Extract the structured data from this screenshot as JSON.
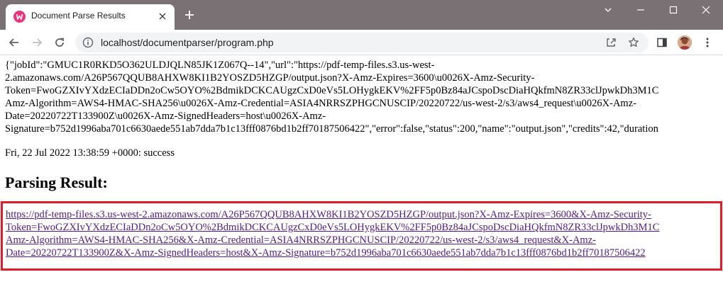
{
  "browser": {
    "tab_title": "Document Parse Results",
    "url": "localhost/documentparser/program.php"
  },
  "page": {
    "json_lines": [
      "{\"jobId\":\"GMUC1R0RKD5O362ULDJQLN85JK1Z067Q--14\",\"url\":\"https://pdf-temp-files.s3.us-west-",
      "2.amazonaws.com/A26P567QQUB8AHXW8KI1B2YOSZD5HZGP/output.json?X-Amz-Expires=3600\\u0026X-Amz-Security-",
      "Token=FwoGZXIvYXdzECIaDDn2oCw5OYO%2BdmikDCKCAUgzCxD0eVs5LOHygkEKV%2FF5p0Bz84aJCspoDscDiaHQkfmN8ZR33clJpwkDh3M1C",
      "Amz-Algorithm=AWS4-HMAC-SHA256\\u0026X-Amz-Credential=ASIA4NRRSZPHGCNUSCIP/20220722/us-west-2/s3/aws4_request\\u0026X-Amz-",
      "Date=20220722T133900Z\\u0026X-Amz-SignedHeaders=host\\u0026X-Amz-",
      "Signature=b752d1996aba701c6630aede551ab7dda7b1c13fff0876bd1b2ff70187506422\",\"error\":false,\"status\":200,\"name\":\"output.json\",\"credits\":42,\"duration"
    ],
    "date_line": "Fri, 22 Jul 2022 13:38:59 +0000: success",
    "heading": "Parsing Result:",
    "result_link_lines": [
      "https://pdf-temp-files.s3.us-west-2.amazonaws.com/A26P567QQUB8AHXW8KI1B2YOSZD5HZGP/output.json?X-Amz-Expires=3600&X-Amz-Security-",
      "Token=FwoGZXIvYXdzECIaDDn2oCw5OYO%2BdmikDCKCAUgzCxD0eVs5LOHygkEKV%2FF5p0Bz84aJCspoDscDiaHQkfmN8ZR33clJpwkDh3M1C",
      "Amz-Algorithm=AWS4-HMAC-SHA256&X-Amz-Credential=ASIA4NRRSZPHGCNUSCIP/20220722/us-west-2/s3/aws4_request&X-Amz-",
      "Date=20220722T133900Z&X-Amz-SignedHeaders=host&X-Amz-Signature=b752d1996aba701c6630aede551ab7dda7b1c13fff0876bd1b2ff70187506422"
    ]
  },
  "colors": {
    "titlebar": "#797173",
    "highlight_border": "#e01b2a",
    "visited_link": "#551a8b"
  },
  "icons": [
    "favicon-icon",
    "close-icon",
    "plus-icon",
    "minimize-icon",
    "maximize-icon",
    "window-close-icon",
    "back-arrow-icon",
    "forward-arrow-icon",
    "reload-icon",
    "info-icon",
    "share-icon",
    "star-icon",
    "side-panel-icon",
    "profile-avatar",
    "more-menu-icon"
  ]
}
